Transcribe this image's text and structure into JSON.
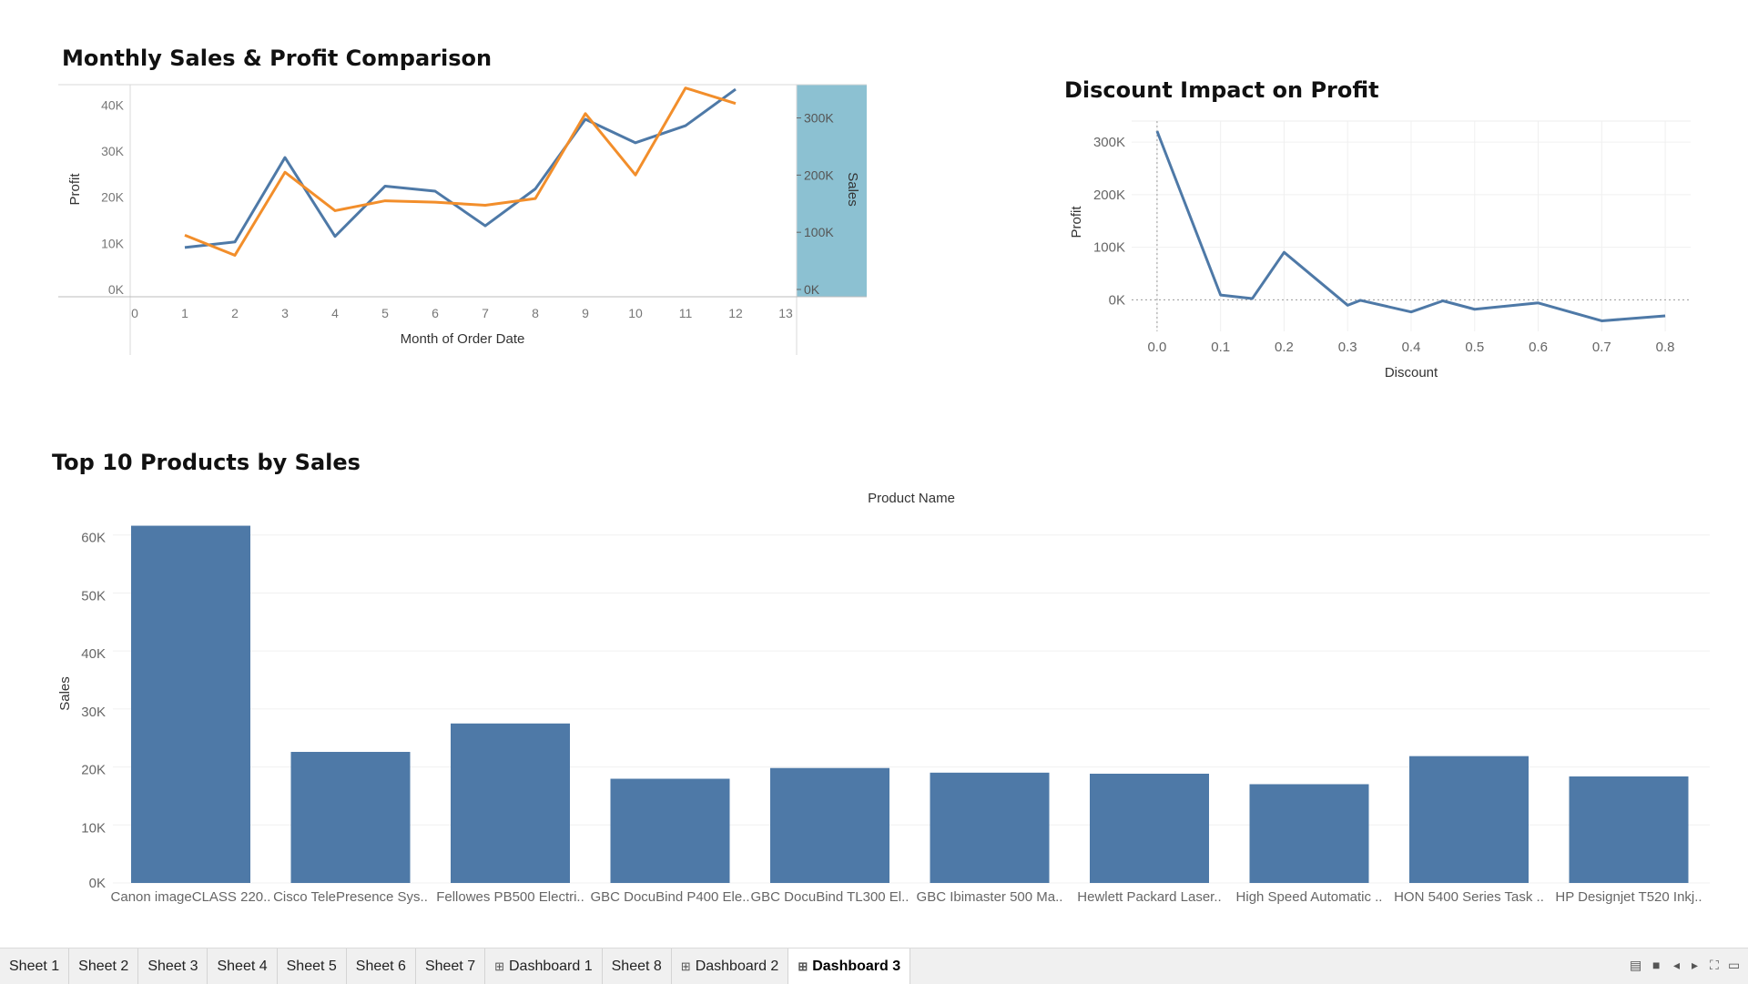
{
  "titles": {
    "monthly": "Monthly Sales & Profit Comparison",
    "discount": "Discount Impact on Profit",
    "top10": "Top 10 Products by Sales"
  },
  "colors": {
    "blue": "#4e79a7",
    "orange": "#f28e2b",
    "highlight": "#8cc1d2"
  },
  "chart_data": [
    {
      "type": "line",
      "title": "Monthly Sales & Profit Comparison",
      "xlabel": "Month of Order Date",
      "ylabel": "Profit",
      "y2label": "Sales",
      "x": [
        1,
        2,
        3,
        4,
        5,
        6,
        7,
        8,
        9,
        10,
        11,
        12
      ],
      "xticks": [
        "0",
        "1",
        "2",
        "3",
        "4",
        "5",
        "6",
        "7",
        "8",
        "9",
        "10",
        "11",
        "12",
        "13"
      ],
      "xlim": [
        0,
        13
      ],
      "ylim": [
        0,
        44000
      ],
      "y2lim": [
        0,
        355000
      ],
      "yticks": [
        "0K",
        "10K",
        "20K",
        "30K",
        "40K"
      ],
      "y2ticks": [
        "0K",
        "100K",
        "200K",
        "300K"
      ],
      "series": [
        {
          "axis": "left",
          "color": "#4e79a7",
          "values": [
            9100,
            10300,
            28600,
            11500,
            22400,
            21300,
            13800,
            21800,
            36900,
            31800,
            35500,
            43400
          ]
        },
        {
          "axis": "right",
          "color": "#f28e2b",
          "values": [
            94900,
            59800,
            205000,
            137800,
            155100,
            152700,
            147200,
            159000,
            307600,
            200300,
            352400,
            325300
          ]
        }
      ]
    },
    {
      "type": "line",
      "title": "Discount Impact on Profit",
      "xlabel": "Discount",
      "ylabel": "Profit",
      "x": [
        0.0,
        0.1,
        0.15,
        0.2,
        0.3,
        0.32,
        0.4,
        0.45,
        0.5,
        0.6,
        0.7,
        0.8
      ],
      "xticks": [
        "0.0",
        "0.1",
        "0.2",
        "0.3",
        "0.4",
        "0.5",
        "0.6",
        "0.7",
        "0.8"
      ],
      "yticks": [
        "0K",
        "100K",
        "200K",
        "300K"
      ],
      "xlim": [
        -0.04,
        0.84
      ],
      "ylim": [
        -60000,
        340000
      ],
      "series": [
        {
          "color": "#4e79a7",
          "values": [
            320987,
            9029,
            2418,
            90338,
            -10369,
            -1000,
            -23057,
            -2000,
            -18000,
            -5944,
            -40075,
            -30539
          ]
        }
      ]
    },
    {
      "type": "bar",
      "title": "Top 10 Products by Sales",
      "header": "Product Name",
      "ylabel": "Sales",
      "ylim": [
        0,
        62000
      ],
      "yticks": [
        "0K",
        "10K",
        "20K",
        "30K",
        "40K",
        "50K",
        "60K"
      ],
      "categories": [
        "Canon imageCLASS 220..",
        "Cisco TelePresence Sys..",
        "Fellowes PB500 Electri..",
        "GBC DocuBind P400 Ele..",
        "GBC DocuBind TL300 El..",
        "GBC Ibimaster 500 Ma..",
        "Hewlett Packard Laser..",
        "High Speed Automatic ..",
        "HON 5400 Series Task ..",
        "HP Designjet T520 Inkj.."
      ],
      "values": [
        61600,
        22600,
        27500,
        17970,
        19820,
        19020,
        18840,
        17030,
        21870,
        18370
      ],
      "color": "#4e79a7"
    }
  ],
  "tabs": [
    {
      "label": "Sheet 1",
      "icon": ""
    },
    {
      "label": "Sheet 2",
      "icon": ""
    },
    {
      "label": "Sheet 3",
      "icon": ""
    },
    {
      "label": "Sheet 4",
      "icon": ""
    },
    {
      "label": "Sheet 5",
      "icon": ""
    },
    {
      "label": "Sheet 6",
      "icon": ""
    },
    {
      "label": "Sheet 7",
      "icon": ""
    },
    {
      "label": "Dashboard 1",
      "icon": "⊞"
    },
    {
      "label": "Sheet 8",
      "icon": ""
    },
    {
      "label": "Dashboard 2",
      "icon": "⊞"
    },
    {
      "label": "Dashboard 3",
      "icon": "⊞",
      "active": true
    }
  ],
  "controls": [
    {
      "name": "grid-view-icon",
      "glyph": "▤"
    },
    {
      "name": "film-strip-icon",
      "glyph": "■"
    },
    {
      "name": "scroll-left-icon",
      "glyph": "◂"
    },
    {
      "name": "scroll-right-icon",
      "glyph": "▸"
    },
    {
      "name": "fit-screen-icon",
      "glyph": "⛶"
    },
    {
      "name": "present-icon",
      "glyph": "▭"
    }
  ]
}
